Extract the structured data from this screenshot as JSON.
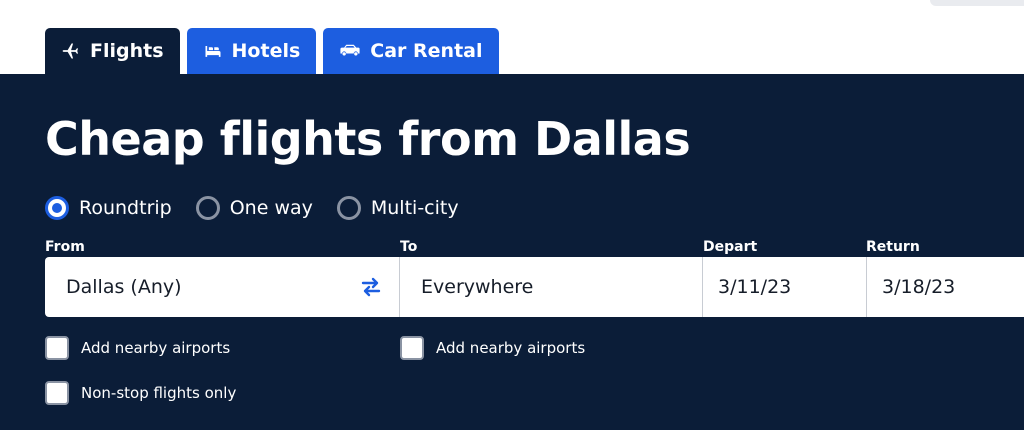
{
  "tabs": [
    {
      "label": "Flights",
      "icon": "airplane-icon",
      "active": true
    },
    {
      "label": "Hotels",
      "icon": "bed-icon",
      "active": false
    },
    {
      "label": "Car Rental",
      "icon": "car-icon",
      "active": false
    }
  ],
  "page_title": "Cheap flights from Dallas",
  "trip_types": [
    {
      "label": "Roundtrip",
      "selected": true
    },
    {
      "label": "One way",
      "selected": false
    },
    {
      "label": "Multi-city",
      "selected": false
    }
  ],
  "search": {
    "from_label": "From",
    "from_value": "Dallas (Any)",
    "to_label": "To",
    "to_value": "Everywhere",
    "depart_label": "Depart",
    "depart_value": "3/11/23",
    "return_label": "Return",
    "return_value": "3/18/23"
  },
  "options": {
    "from_nearby": "Add nearby airports",
    "to_nearby": "Add nearby airports",
    "nonstop": "Non-stop flights only"
  },
  "colors": {
    "panel_bg": "#0b1d38",
    "accent_blue": "#1d5ee0",
    "text_white": "#ffffff"
  }
}
